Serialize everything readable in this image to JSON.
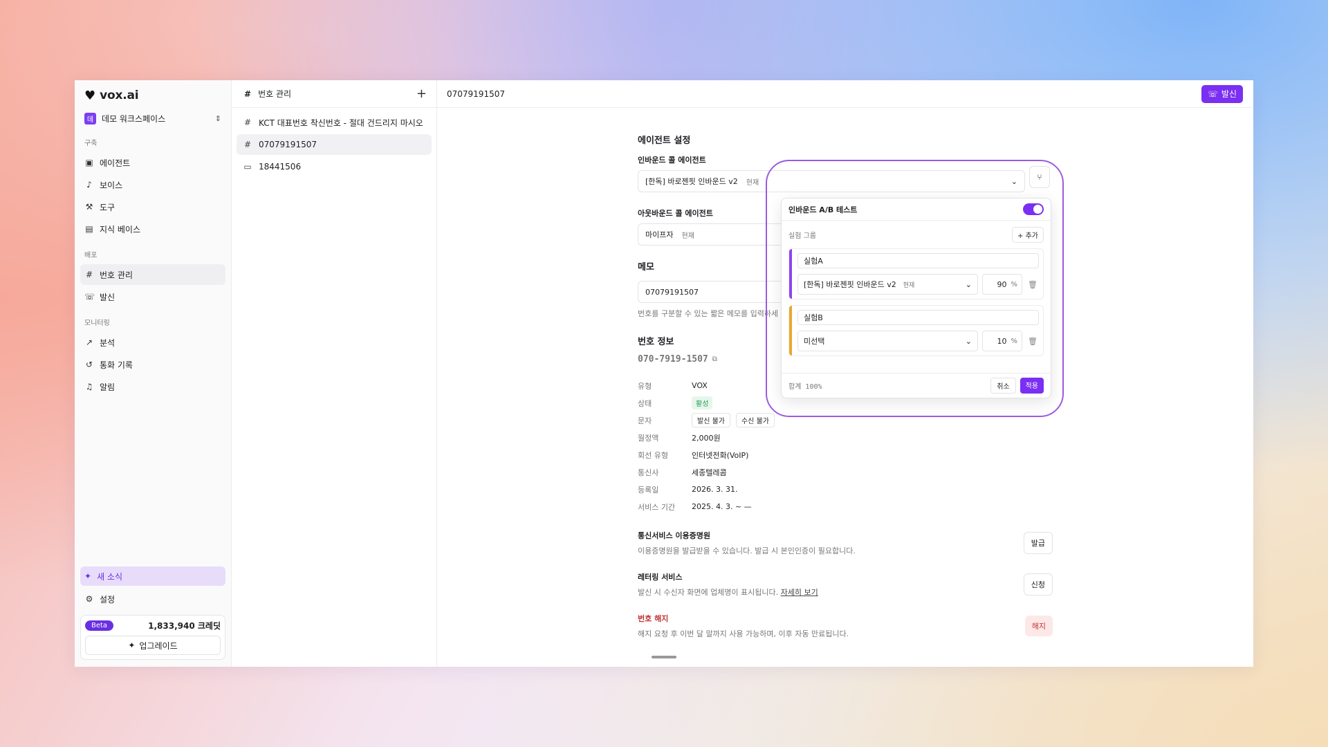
{
  "app": {
    "logo_text": "vox.ai"
  },
  "sidebar": {
    "workspace": {
      "badge": "데",
      "name": "데모 워크스페이스"
    },
    "sections": [
      {
        "label": "구축",
        "items": [
          "에이전트",
          "보이스",
          "도구",
          "지식 베이스"
        ]
      },
      {
        "label": "배포",
        "items": [
          "번호 관리",
          "발신"
        ]
      },
      {
        "label": "모니터링",
        "items": [
          "분석",
          "통화 기록",
          "알림"
        ]
      }
    ],
    "news_label": "새 소식",
    "settings_label": "설정",
    "beta_label": "Beta",
    "credits": "1,833,940 크레딧",
    "upgrade_label": "업그레이드"
  },
  "list_panel": {
    "title": "번호 관리",
    "items": [
      {
        "label": "KCT 대표번호 착신번호 - 절대 건드리지 마시오"
      },
      {
        "label": "07079191507"
      },
      {
        "label": "18441506"
      }
    ]
  },
  "main": {
    "title": "07079191507",
    "call_button": "발신",
    "agent_settings_title": "에이전트 설정",
    "inbound_label": "인바운드 콜 에이전트",
    "inbound_value": "[한독] 바로젠핏 인바운드 v2",
    "inbound_tag": "현재",
    "outbound_label": "아웃바운드 콜 에이전트",
    "outbound_value": "마이프자",
    "outbound_tag": "현재",
    "memo_title": "메모",
    "memo_value": "07079191507",
    "memo_hint": "번호를 구분할 수 있는 짧은 메모를 입력하세",
    "number_info_title": "번호 정보",
    "phone_display": "070-7919-1507",
    "info": {
      "type_key": "유형",
      "type_val": "VOX",
      "status_key": "상태",
      "status_val": "활성",
      "sms_key": "문자",
      "sms_send": "발신 불가",
      "sms_recv": "수신 불가",
      "fee_key": "월정액",
      "fee_val": "2,000원",
      "line_key": "회선 유형",
      "line_val": "인터넷전화(VoIP)",
      "carrier_key": "통신사",
      "carrier_val": "세종텔레콤",
      "reg_key": "등록일",
      "reg_val": "2026. 3. 31.",
      "period_key": "서비스 기간",
      "period_val": "2025. 4. 3. ~ —"
    },
    "cert_title": "통신서비스 이용증명원",
    "cert_desc": "이용증명원을 발급받을 수 있습니다. 발급 시 본인인증이 필요합니다.",
    "cert_button": "발급",
    "lettering_title": "레터링 서비스",
    "lettering_desc": "발신 시 수신자 화면에 업체명이 표시됩니다.",
    "lettering_link": "자세히 보기",
    "lettering_button": "신청",
    "cancel_title": "번호 해지",
    "cancel_desc": "해지 요청 후 이번 달 말까지 사용 가능하며, 이후 자동 만료됩니다.",
    "cancel_button": "해지"
  },
  "ab_test": {
    "title": "인바운드 A/B 테스트",
    "enabled": true,
    "group_label": "실험 그룹",
    "add_label": "+ 추가",
    "groups": [
      {
        "name": "실험A",
        "agent": "[한독] 바로젠핏 인바운드 v2",
        "tag": "현재",
        "percent": "90",
        "color": "#8b45f0"
      },
      {
        "name": "실험B",
        "agent": "미선택",
        "tag": "",
        "percent": "10",
        "color": "#e8a92e"
      }
    ],
    "percent_unit": "%",
    "total": "합계 100%",
    "cancel_label": "취소",
    "apply_label": "적용"
  }
}
